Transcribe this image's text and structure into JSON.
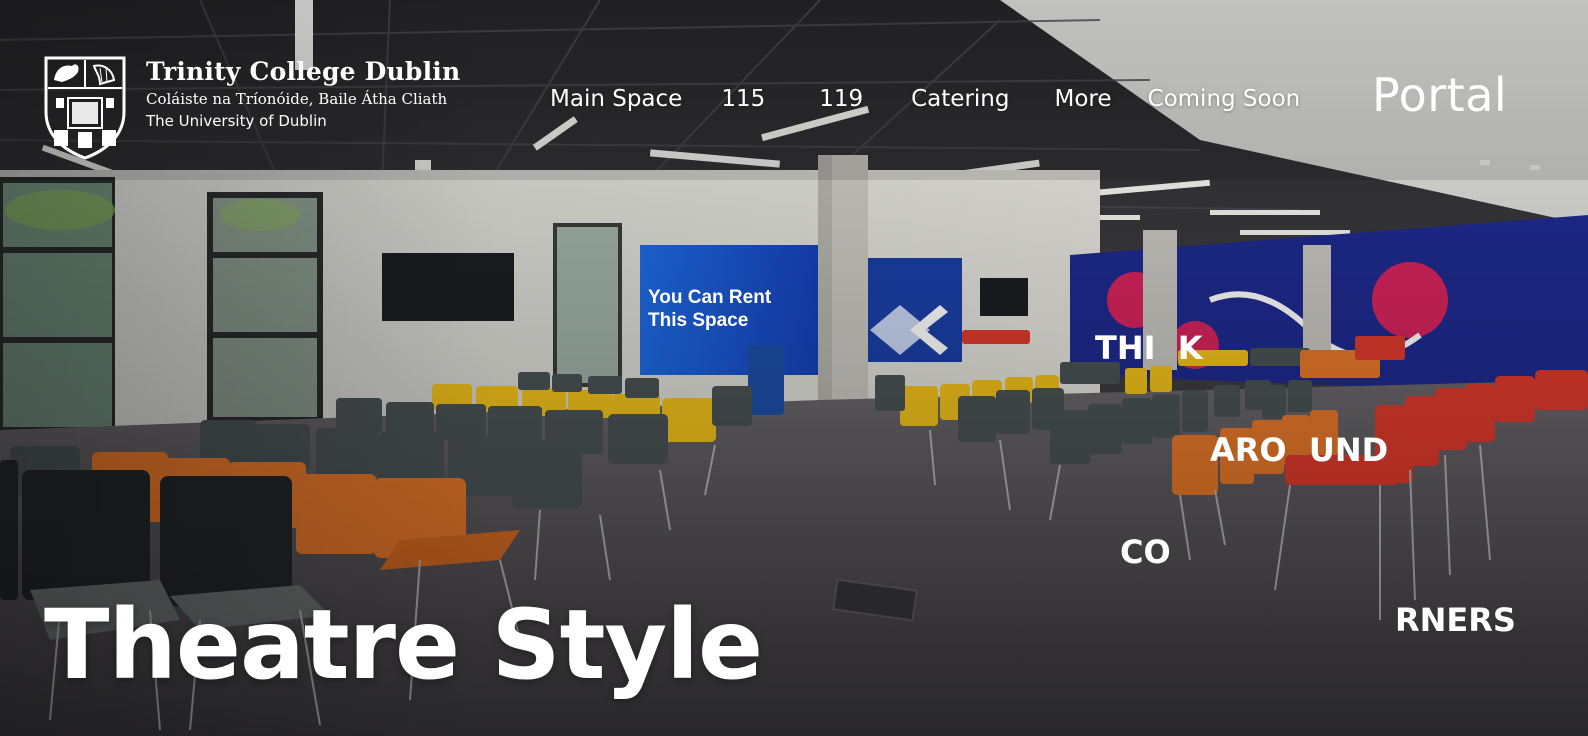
{
  "brand": {
    "name": "Trinity College Dublin",
    "irish": "Coláiste na Tríonóide, Baile Átha Cliath",
    "university": "The University of Dublin"
  },
  "nav": [
    {
      "label": "Main Space"
    },
    {
      "label": "115"
    },
    {
      "label": "119"
    },
    {
      "label": "Catering"
    },
    {
      "label": "More"
    },
    {
      "label": "Coming Soon"
    }
  ],
  "portal": "Portal",
  "hero": {
    "title": "Theatre Style",
    "screen": {
      "line1": "You Can Rent",
      "line2": "This Space"
    },
    "mural": {
      "line1": "THI  K",
      "line2": "ARO  UND",
      "line3": "CO",
      "line4": "RNERS"
    }
  },
  "colors": {
    "ceiling": "#2f2f33",
    "floor": "#56545a",
    "wall": "#d9d8d2",
    "mural_blue": "#1e2a8f",
    "chair_orange": "#e8782a",
    "chair_yellow": "#f2c21b",
    "chair_red": "#e03a2c",
    "chair_grey": "#4a5355",
    "screen_blue": "#1c5fd8"
  }
}
